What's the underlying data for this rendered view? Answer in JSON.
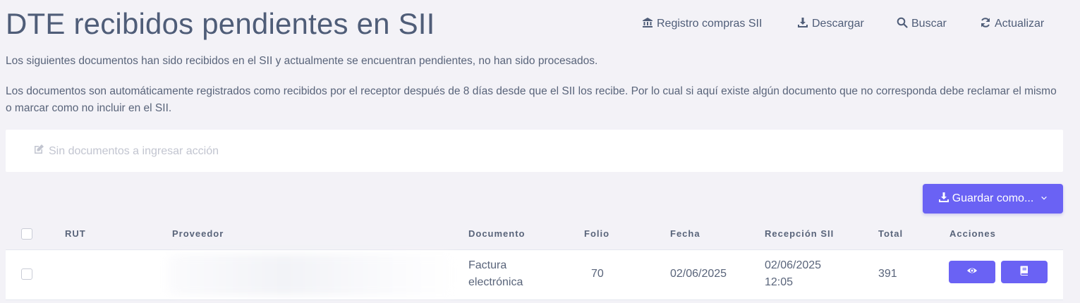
{
  "page": {
    "title": "DTE recibidos pendientes en SII",
    "description_1": "Los siguientes documentos han sido recibidos en el SII y actualmente se encuentran pendientes, no han sido procesados.",
    "description_2": "Los documentos son automáticamente registrados como recibidos por el receptor después de 8 días desde que el SII los recibe. Por lo cual si aquí existe algún documento que no corresponda debe reclamar el mismo o marcar como no incluir en el SII."
  },
  "toolbar": {
    "registro_label": "Registro compras SII",
    "registro_icon": "bank-icon",
    "descargar_label": "Descargar",
    "descargar_icon": "download-icon",
    "buscar_label": "Buscar",
    "buscar_icon": "search-icon",
    "actualizar_label": "Actualizar",
    "actualizar_icon": "refresh-icon"
  },
  "action_bar": {
    "label": "Sin documentos a ingresar acción",
    "icon": "edit-icon"
  },
  "save_as": {
    "label": "Guardar como...",
    "icon": "download-icon",
    "dropdown_icon": "chevron-down-icon"
  },
  "table": {
    "columns": [
      "RUT",
      "Proveedor",
      "Documento",
      "Folio",
      "Fecha",
      "Recepción SII",
      "Total",
      "Acciones"
    ],
    "rows": [
      {
        "rut": "",
        "proveedor": "",
        "documento_line1": "Factura",
        "documento_line2": "electrónica",
        "folio": "70",
        "fecha": "02/06/2025",
        "recepcion_date": "02/06/2025",
        "recepcion_time": "12:05",
        "total": "391",
        "actions": [
          "view-icon",
          "book-icon"
        ]
      }
    ]
  },
  "colors": {
    "background": "#f3f2f7",
    "accent": "#6a62f4",
    "text": "#59647a",
    "title": "#4f5d78"
  }
}
